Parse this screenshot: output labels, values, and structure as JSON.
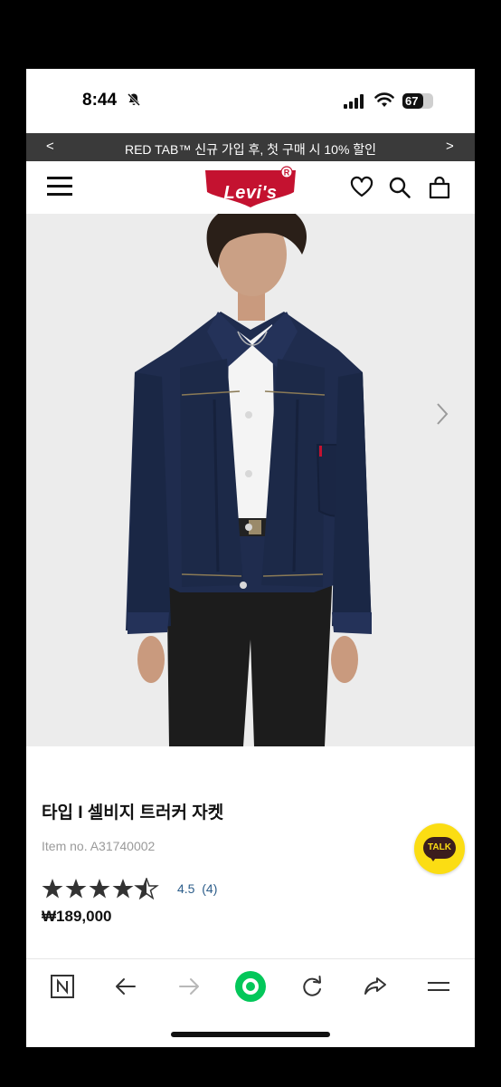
{
  "status": {
    "time": "8:44",
    "battery": "67",
    "icons": [
      "bell-slash-icon",
      "signal-icon",
      "wifi-icon",
      "battery-icon"
    ]
  },
  "promo": {
    "text": "RED TAB™ 신규 가입 후, 첫 구매 시 10% 할인",
    "prev": "<",
    "next": ">"
  },
  "header": {
    "brand": "Levi's",
    "icons": [
      "menu-icon",
      "heart-icon",
      "search-icon",
      "bag-icon"
    ]
  },
  "product": {
    "name": "타입 I 셀비지 트러커 자켓",
    "item_no": "Item no. A31740002",
    "rating_value": 4.5,
    "rating_text": "4.5",
    "review_count": "(4)",
    "price": "₩189,000"
  },
  "chat": {
    "label": "TALK"
  },
  "browser": {
    "icons": [
      "naver-n-icon",
      "back-arrow-icon",
      "forward-arrow-icon",
      "home-dot-icon",
      "refresh-icon",
      "share-icon",
      "menu-icon"
    ]
  },
  "colors": {
    "promo_bg": "#3a3a3a",
    "brand_red": "#c41230",
    "rating_blue": "#2c5d8a",
    "talk_yellow": "#fbdd13",
    "browser_green": "#03c75a"
  }
}
